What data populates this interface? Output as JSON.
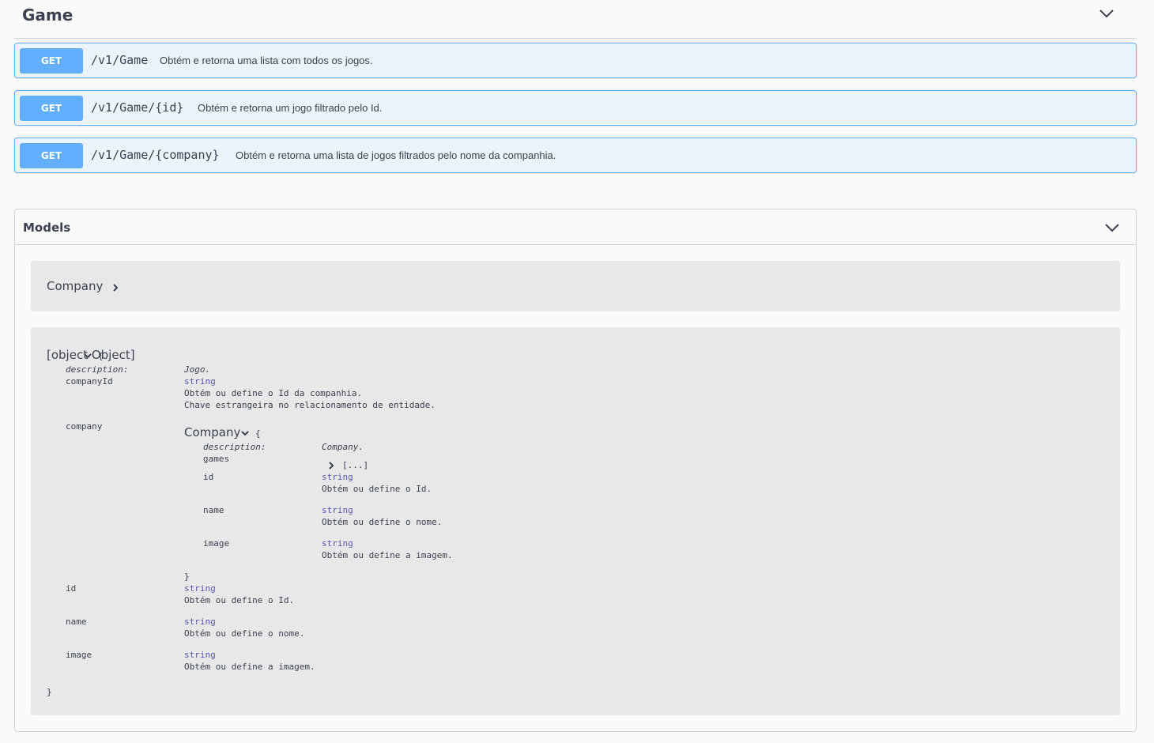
{
  "tag": {
    "title": "Game"
  },
  "operations": [
    {
      "method": "GET",
      "path": "/v1/Game",
      "summary": "Obtém e retorna uma lista com todos os jogos."
    },
    {
      "method": "GET",
      "path": "/v1/Game/{id}",
      "summary": "Obtém e retorna um jogo filtrado pelo Id."
    },
    {
      "method": "GET",
      "path": "/v1/Game/{company}",
      "summary": "Obtém e retorna uma lista de jogos filtrados pelo nome da companhia."
    }
  ],
  "models": {
    "title": "Models",
    "company_collapsed": {
      "name": "Company"
    },
    "game": {
      "name": {
        "label": "name",
        "type": "string",
        "desc": "Obtém ou define o nome."
      },
      "open_brace": "{",
      "close_brace": "}",
      "description_label": "description:",
      "description_value": "Jogo.",
      "companyId": {
        "label": "companyId",
        "type": "string",
        "line1": "Obtém ou define o Id da companhia.",
        "line2": "Chave estrangeira no relacionamento de entidade."
      },
      "company": {
        "label": "company",
        "model_name": "Company",
        "open_brace": "{",
        "close_brace": "}",
        "description_label": "description:",
        "description_value": "Company.",
        "games": {
          "label": "games",
          "value": "[...]"
        },
        "id": {
          "label": "id",
          "type": "string",
          "desc": "Obtém ou define o Id."
        },
        "name": {
          "label": "name",
          "type": "string",
          "desc": "Obtém ou define o nome."
        },
        "image": {
          "label": "image",
          "type": "string",
          "desc": "Obtém ou define a imagem."
        }
      },
      "id": {
        "label": "id",
        "type": "string",
        "desc": "Obtém ou define o Id."
      },
      "image": {
        "label": "image",
        "type": "string",
        "desc": "Obtém ou define a imagem."
      }
    }
  },
  "colors": {
    "get_method": "#61affe",
    "get_background": "#ebf3fb",
    "model_background": "#e8e8e8",
    "type_color": "#5555aa"
  }
}
